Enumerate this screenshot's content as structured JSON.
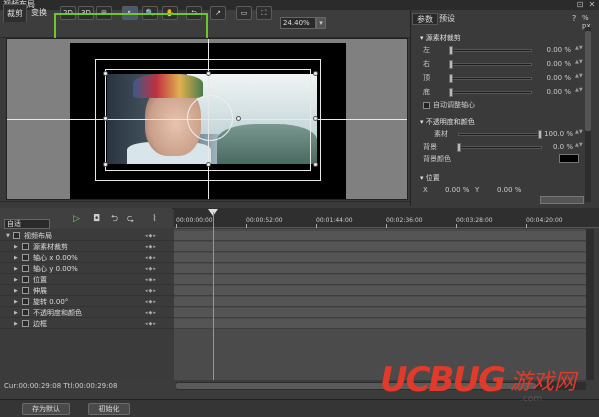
{
  "window": {
    "title": "视频布局",
    "pin_icon": "pin-icon",
    "close_icon": "close-icon"
  },
  "toolbar": {
    "tabs": [
      "裁剪",
      "变换"
    ],
    "buttons": [
      "2D",
      "3D",
      "⊞",
      "↖",
      "🔍",
      "✋",
      "⮌",
      "↗",
      "▭",
      "⛶"
    ],
    "zoom_value": "24.40%"
  },
  "right_panel": {
    "tabs": [
      "参数",
      "预设"
    ],
    "crop_section": "源素材裁剪",
    "crop_items": [
      {
        "label": "左",
        "value": "0.00 %"
      },
      {
        "label": "右",
        "value": "0.00 %"
      },
      {
        "label": "顶",
        "value": "0.00 %"
      },
      {
        "label": "底",
        "value": "0.00 %"
      }
    ],
    "auto_center": "自动调整轴心",
    "opacity_section": "不透明度和颜色",
    "opacity_items": [
      {
        "label": "素材",
        "value": "100.0 %"
      },
      {
        "label": "背景",
        "value": "0.0 %"
      }
    ],
    "bg_color_label": "背景颜色",
    "position_section": "位置",
    "position_x_label": "X",
    "position_x_value": "0.00 %",
    "position_y_label": "Y",
    "position_y_value": "0.00 %",
    "help_icon": "?"
  },
  "timeline": {
    "preset": "自适",
    "ruler": [
      "00:00:00:00",
      "00:00:52:00",
      "00:01:44:00",
      "00:02:36:00",
      "00:03:28:00",
      "00:04:20:00"
    ],
    "tracks": [
      {
        "label": "视频布局",
        "level": 0
      },
      {
        "label": "源素材裁剪",
        "level": 1
      },
      {
        "label": "轴心 x  0.00%",
        "level": 1
      },
      {
        "label": "轴心 y  0.00%",
        "level": 1
      },
      {
        "label": "位置",
        "level": 1
      },
      {
        "label": "伸展",
        "level": 1
      },
      {
        "label": "旋转  0.00°",
        "level": 1
      },
      {
        "label": "不透明度和颜色",
        "level": 1
      },
      {
        "label": "边框",
        "level": 1
      }
    ],
    "status": "Cur:00:00:29:08 Ttl:00:00:29:08"
  },
  "footer": {
    "reset_default": "存为默认",
    "initialize": "初始化"
  },
  "watermark": {
    "brand": "UCBUG",
    "cn": "游戏网",
    "url": ".com"
  },
  "colors": {
    "highlight": "#6dc72a",
    "playhead": "#4fb0d8",
    "watermark": "#e23a2a"
  }
}
